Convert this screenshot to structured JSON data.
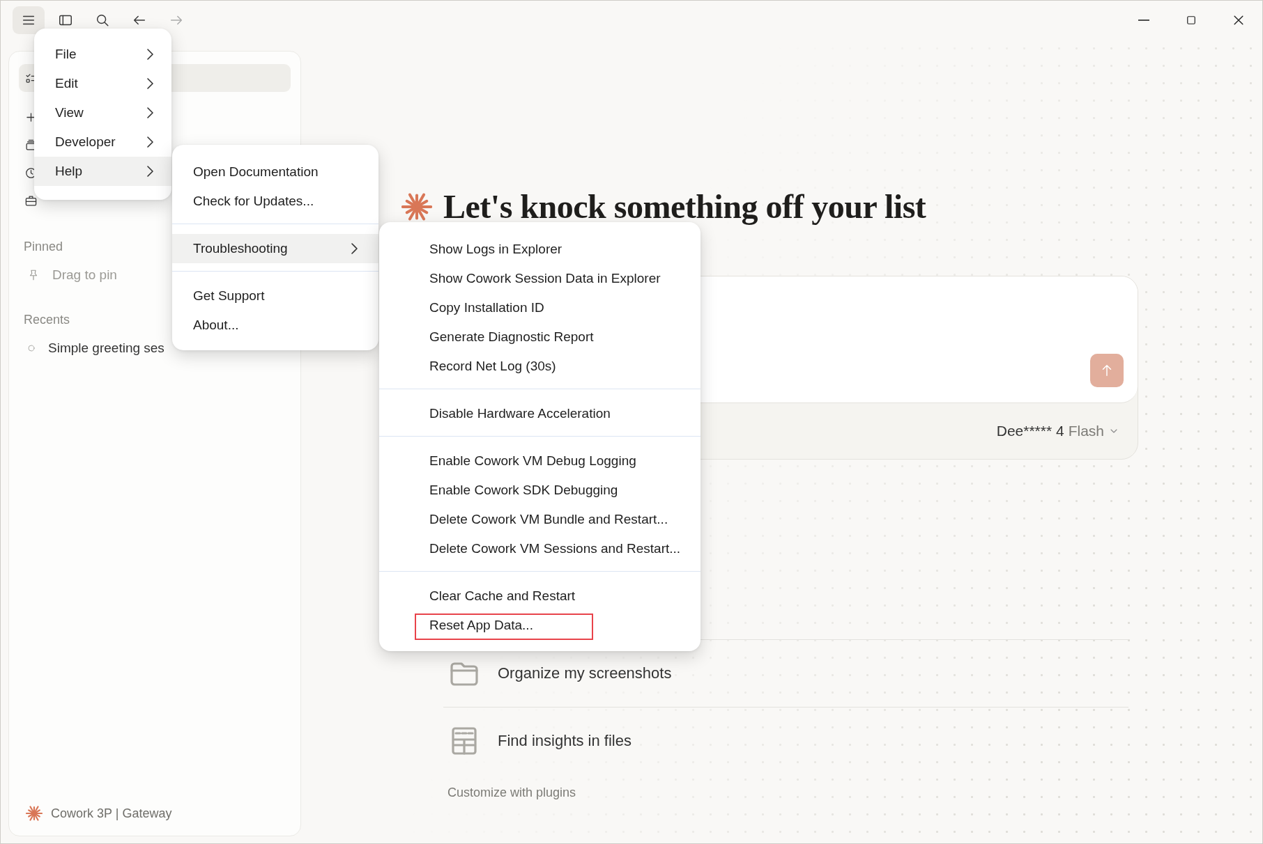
{
  "app_menu": {
    "items": [
      {
        "label": "File",
        "has_submenu": true,
        "selected": false
      },
      {
        "label": "Edit",
        "has_submenu": true,
        "selected": false
      },
      {
        "label": "View",
        "has_submenu": true,
        "selected": false
      },
      {
        "label": "Developer",
        "has_submenu": true,
        "selected": false
      },
      {
        "label": "Help",
        "has_submenu": true,
        "selected": true
      }
    ]
  },
  "help_menu": {
    "items": [
      {
        "kind": "item",
        "label": "Open Documentation",
        "has_submenu": false,
        "selected": false
      },
      {
        "kind": "item",
        "label": "Check for Updates...",
        "has_submenu": false,
        "selected": false
      },
      {
        "kind": "separator"
      },
      {
        "kind": "item",
        "label": "Troubleshooting",
        "has_submenu": true,
        "selected": true
      },
      {
        "kind": "separator"
      },
      {
        "kind": "item",
        "label": "Get Support",
        "has_submenu": false,
        "selected": false
      },
      {
        "kind": "item",
        "label": "About...",
        "has_submenu": false,
        "selected": false
      }
    ]
  },
  "troubleshooting_menu": {
    "items": [
      {
        "kind": "item",
        "label": "Show Logs in Explorer",
        "highlighted": false
      },
      {
        "kind": "item",
        "label": "Show Cowork Session Data in Explorer",
        "highlighted": false
      },
      {
        "kind": "item",
        "label": "Copy Installation ID",
        "highlighted": false
      },
      {
        "kind": "item",
        "label": "Generate Diagnostic Report",
        "highlighted": false
      },
      {
        "kind": "item",
        "label": "Record Net Log (30s)",
        "highlighted": false
      },
      {
        "kind": "separator"
      },
      {
        "kind": "item",
        "label": "Disable Hardware Acceleration",
        "highlighted": false
      },
      {
        "kind": "separator"
      },
      {
        "kind": "item",
        "label": "Enable Cowork VM Debug Logging",
        "highlighted": false
      },
      {
        "kind": "item",
        "label": "Enable Cowork SDK Debugging",
        "highlighted": false
      },
      {
        "kind": "item",
        "label": "Delete Cowork VM Bundle and Restart...",
        "highlighted": false
      },
      {
        "kind": "item",
        "label": "Delete Cowork VM Sessions and Restart...",
        "highlighted": false
      },
      {
        "kind": "separator"
      },
      {
        "kind": "item",
        "label": "Clear Cache and Restart",
        "highlighted": false
      },
      {
        "kind": "item",
        "label": "Reset App Data...",
        "highlighted": true
      }
    ]
  },
  "sidebar": {
    "nav": [
      {
        "selected": true
      },
      {
        "selected": false
      },
      {
        "selected": false
      },
      {
        "selected": false
      },
      {
        "selected": false
      }
    ],
    "pinned_label": "Pinned",
    "pinned_hint": "Drag to pin",
    "recents_label": "Recents",
    "recents": [
      {
        "title": "Simple greeting ses"
      }
    ],
    "footer": "Cowork 3P | Gateway"
  },
  "main": {
    "heading": "Let's knock something off your list",
    "model": {
      "name": "Dee***** 4",
      "variant": "Flash"
    },
    "suggestions": [
      {
        "label": "Organize my screenshots"
      },
      {
        "label": "Find insights in files"
      }
    ],
    "customize_link": "Customize with plugins"
  }
}
